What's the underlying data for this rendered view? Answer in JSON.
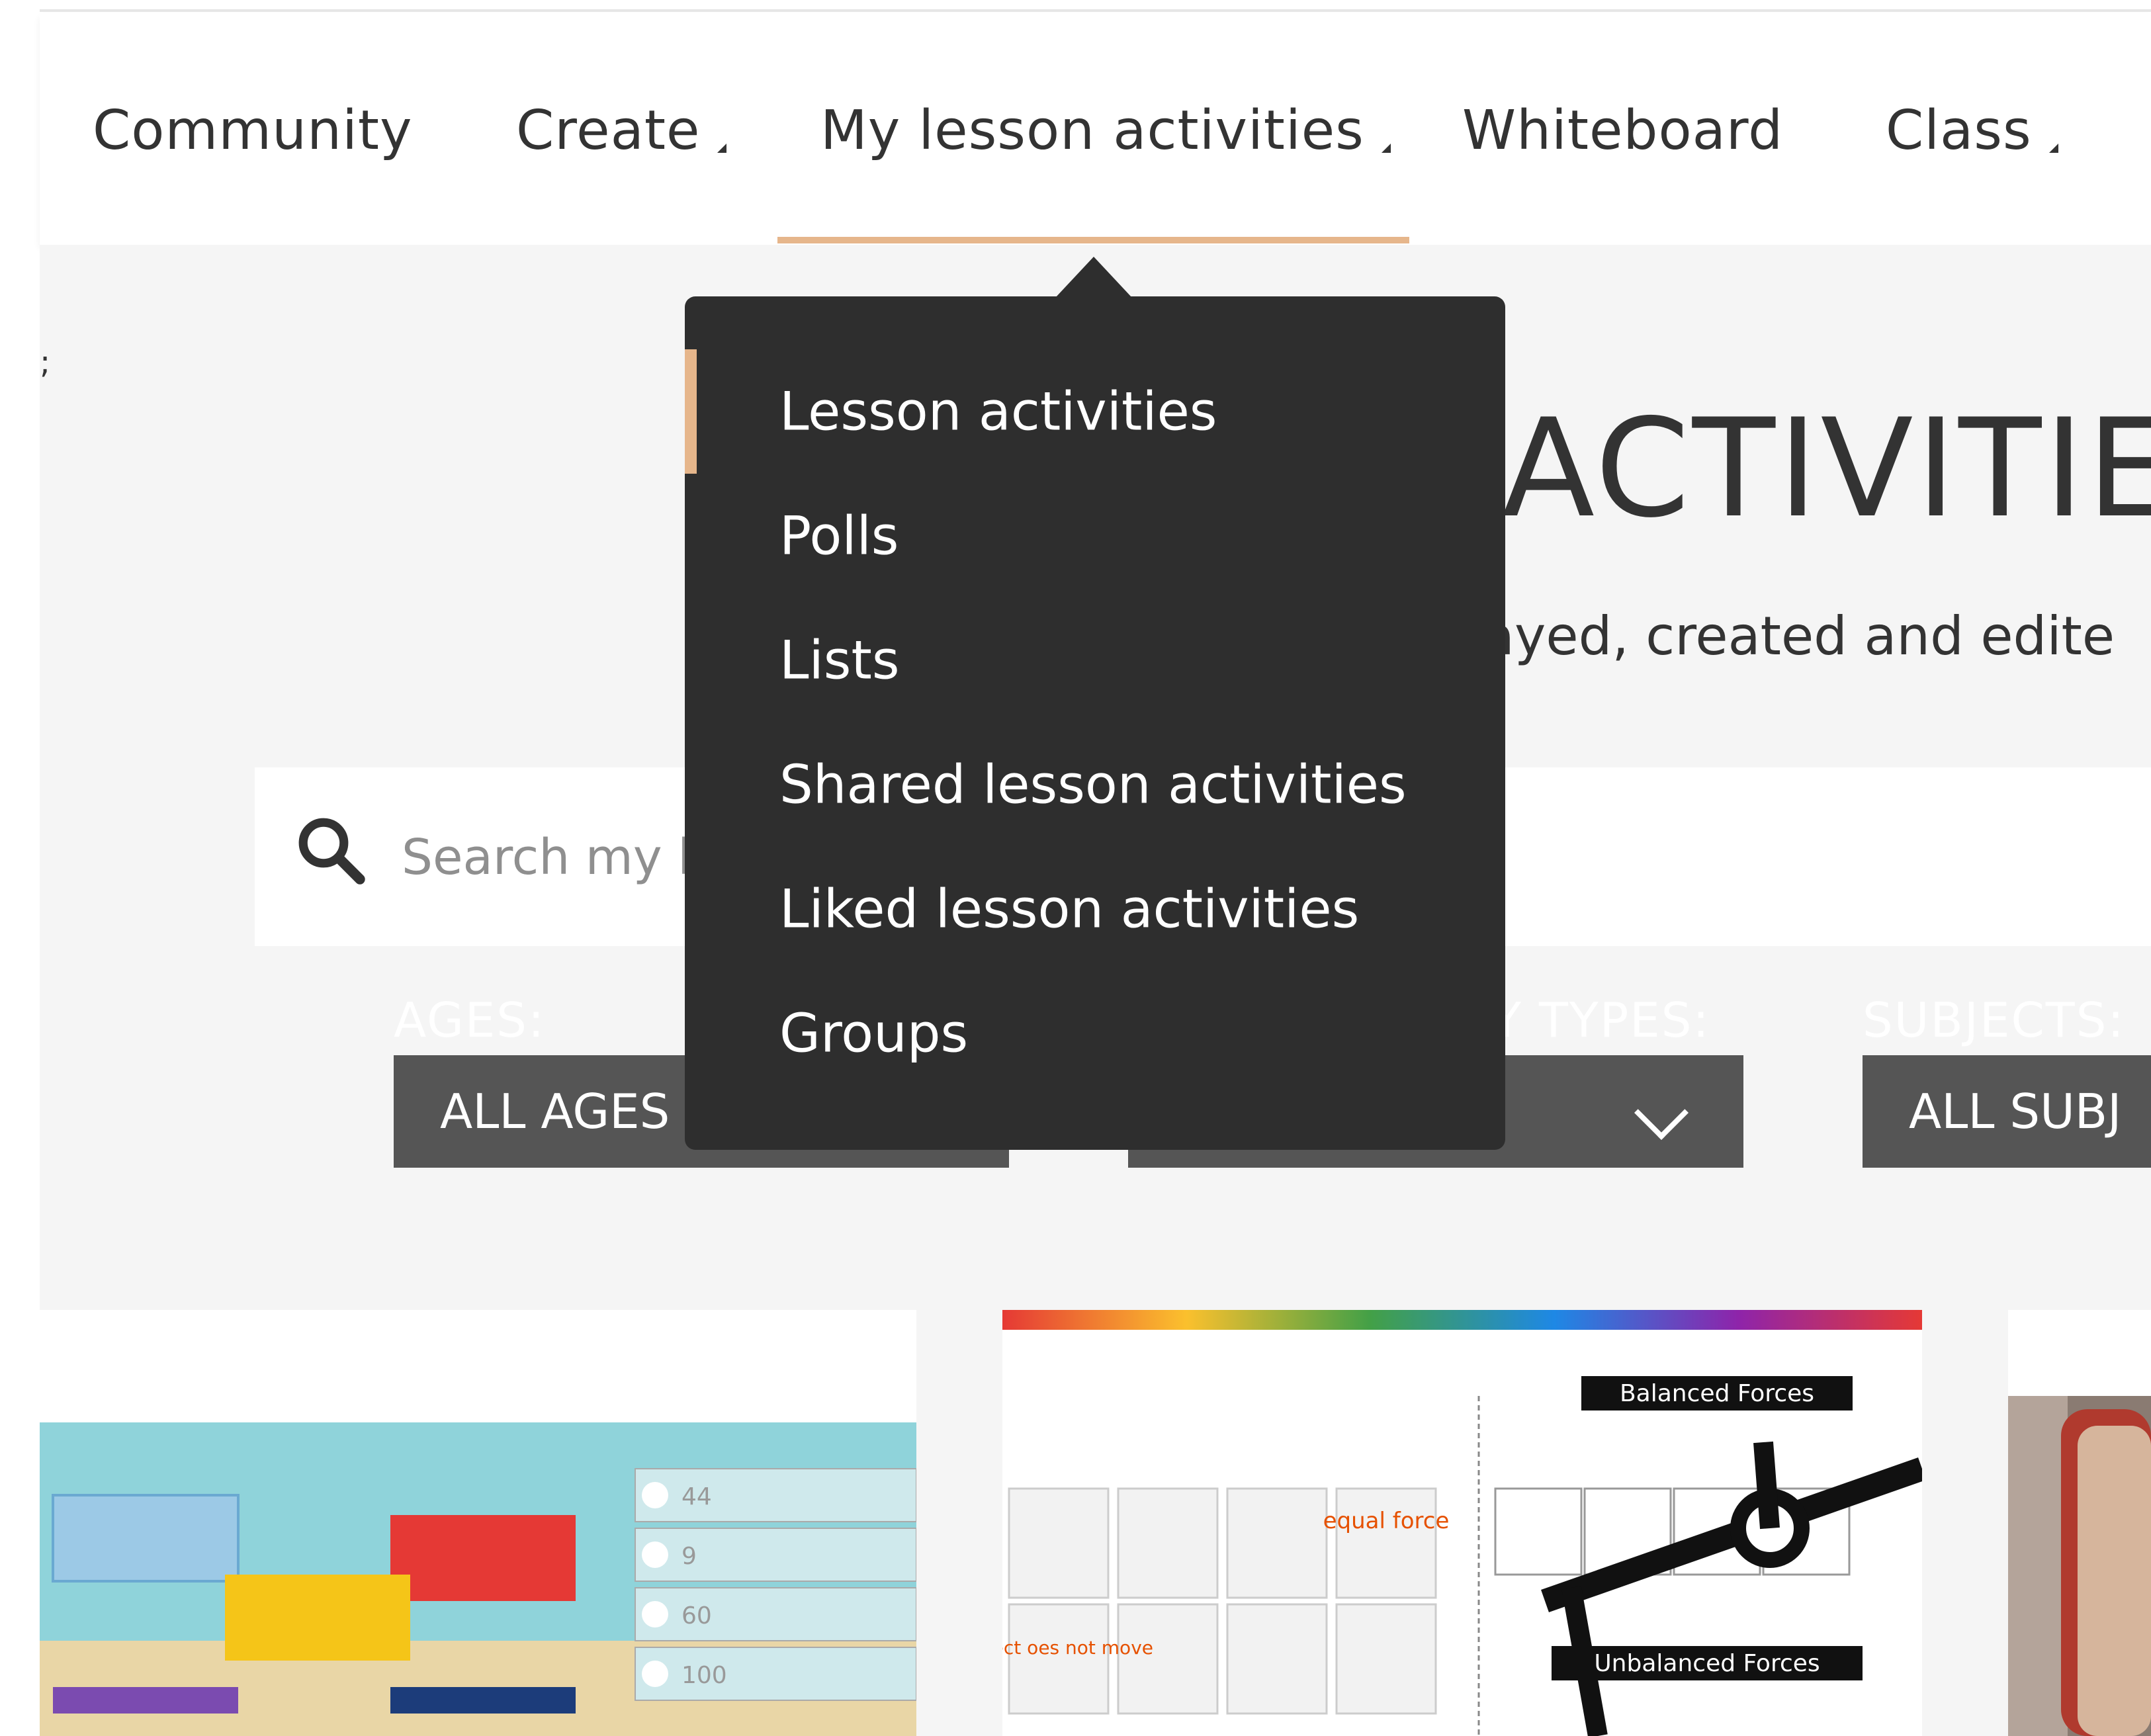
{
  "nav": {
    "items": [
      {
        "label": "Community",
        "has_caret": false
      },
      {
        "label": "Create",
        "has_caret": true
      },
      {
        "label": "My lesson activities",
        "has_caret": true,
        "active": true
      },
      {
        "label": "Whiteboard",
        "has_caret": false
      },
      {
        "label": "Class",
        "has_caret": true
      }
    ]
  },
  "dropdown": {
    "items": [
      {
        "label": "Lesson activities",
        "active": true
      },
      {
        "label": "Polls"
      },
      {
        "label": "Lists"
      },
      {
        "label": "Shared lesson activities"
      },
      {
        "label": "Liked lesson activities"
      },
      {
        "label": "Groups"
      }
    ]
  },
  "page": {
    "title_visible": "ACTIVITIES",
    "subtitle_visible": "ayed, created and edite",
    "edge_mark": ";"
  },
  "search": {
    "placeholder": "Search my le"
  },
  "filters": {
    "ages": {
      "label": "AGES:",
      "value": "ALL AGES"
    },
    "types": {
      "label": "Y TYPES:",
      "value": ""
    },
    "subjects": {
      "label": "SUBJECTS:",
      "value": "ALL SUBJ"
    }
  },
  "cards": {
    "card1": {
      "values": [
        "44",
        "9",
        "60",
        "100"
      ]
    },
    "card2": {
      "balanced_label": "Balanced Forces",
      "unbalanced_label": "Unbalanced Forces",
      "equal_force": "equal force",
      "object_move": "object oes not move"
    }
  },
  "colors": {
    "accent": "#e6b68b",
    "menu_bg": "#2e2e2e",
    "select_bg": "#555555",
    "page_bg": "#f5f5f5"
  }
}
